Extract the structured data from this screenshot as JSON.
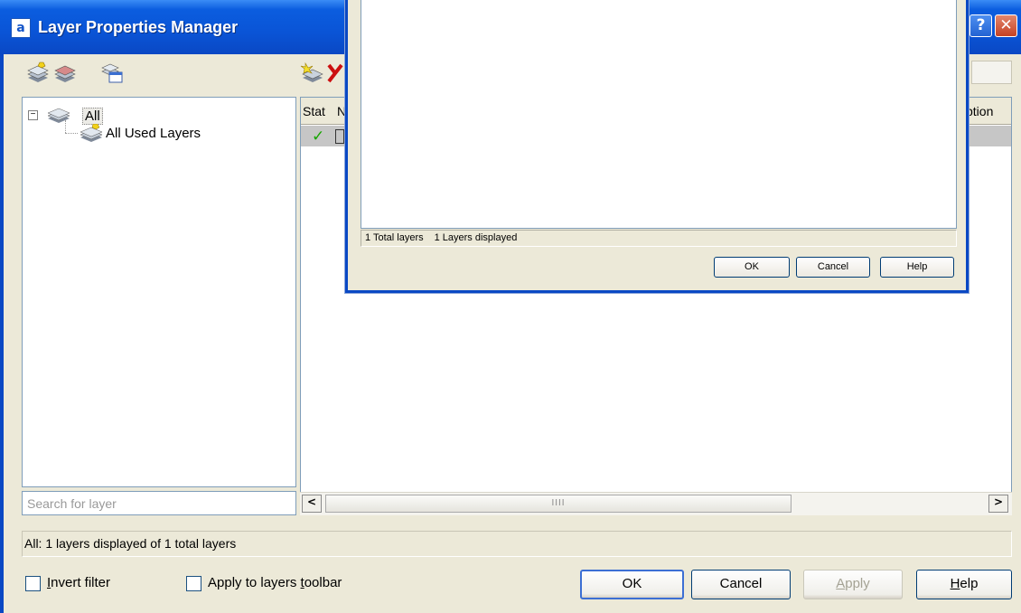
{
  "window": {
    "title": "Layer Properties Manager",
    "help_glyph": "?",
    "close_glyph": "✕"
  },
  "toolbar_left": {
    "icons": [
      "new-property-filter-icon",
      "new-group-filter-icon",
      "layer-states-manager-icon"
    ]
  },
  "toolbar_right": {
    "icons": [
      "new-layer-icon",
      "delete-layer-icon"
    ]
  },
  "tree": {
    "root_label": "All",
    "child_label": "All Used Layers",
    "expand_glyph": "−"
  },
  "search": {
    "placeholder": "Search for layer"
  },
  "layer_list": {
    "columns": [
      "Stat",
      "N",
      "ption"
    ],
    "rows": [
      {
        "status_icon": "current-layer-checkmark-icon",
        "status_glyph": "✓"
      }
    ]
  },
  "scrollbar": {
    "left_arrow": "<",
    "right_arrow": ">",
    "grip": "IIII"
  },
  "status_text": "All: 1 layers displayed of 1 total layers",
  "options": {
    "invert_filter": {
      "label_accel": "I",
      "label_rest": "nvert filter",
      "checked": false
    },
    "apply_toolbar": {
      "label_pre": "Apply to layers ",
      "label_accel": "t",
      "label_post": "oolbar",
      "checked": false
    }
  },
  "buttons": {
    "ok": "OK",
    "cancel": "Cancel",
    "apply_accel": "A",
    "apply_rest": "pply",
    "help_accel": "H",
    "help_rest": "elp"
  },
  "overlay": {
    "total_layers": "1 Total layers",
    "layers_displayed": "1 Layers displayed",
    "ok": "OK",
    "cancel": "Cancel",
    "help": "Help"
  },
  "colors": {
    "titlebar": "#0a54d6",
    "dialog_face": "#ece9d8",
    "selected_row": "#c6c6c6",
    "close_button": "#c54224"
  }
}
